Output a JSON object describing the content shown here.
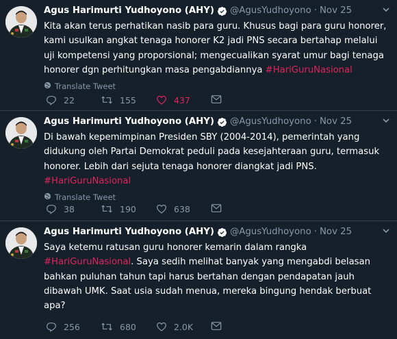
{
  "tweets": [
    {
      "name": "Agus Harimurti Yudhoyono (AHY)",
      "handle": "@AgusYudhoyono",
      "separator": "·",
      "time": "Nov 25",
      "text": "Kita akan terus perhatikan nasib para guru. Khusus bagi para guru honorer, kami usulkan angkat tenaga honorer K2 jadi PNS secara bertahap melalui uji kompetensi yang proporsional; mengecualikan syarat umur bagi tenaga honorer dgn perhitungkan masa pengabdiannya ",
      "text_after": "",
      "hashtag": "#HariGuruNasional",
      "translate_label": "Translate Tweet",
      "replies": "22",
      "retweets": "155",
      "likes": "437",
      "liked": true
    },
    {
      "name": "Agus Harimurti Yudhoyono (AHY)",
      "handle": "@AgusYudhoyono",
      "separator": "·",
      "time": "Nov 25",
      "text": "Di bawah kepemimpinan Presiden SBY (2004-2014), pemerintah yang didukung oleh Partai Demokrat peduli pada kesejahteraan guru, termasuk honorer. Lebih dari sejuta tenaga honorer diangkat jadi PNS. ",
      "text_after": "",
      "hashtag": "#HariGuruNasional",
      "translate_label": "Translate Tweet",
      "replies": "38",
      "retweets": "190",
      "likes": "638",
      "liked": false
    },
    {
      "name": "Agus Harimurti Yudhoyono (AHY)",
      "handle": "@AgusYudhoyono",
      "separator": "·",
      "time": "Nov 25",
      "text": "Saya ketemu ratusan guru honorer kemarin dalam rangka ",
      "hashtag": "#HariGuruNasional",
      "text_after": ". Saya sedih melihat banyak yang mengabdi belasan bahkan puluhan tahun tapi harus bertahan dengan pendapatan jauh dibawah UMK. Saat usia sudah menua, mereka bingung hendak berbuat apa?",
      "translate_label": "",
      "replies": "256",
      "retweets": "680",
      "likes": "2.0K",
      "liked": false
    }
  ],
  "colors": {
    "background": "#15202b",
    "divider": "#38444d",
    "muted": "#8899a6",
    "hashtag": "#e0245e",
    "liked": "#e0245e",
    "verified": "#ffffff"
  },
  "icons": [
    "avatar",
    "verified-icon",
    "chevron-down-icon",
    "globe-icon",
    "reply-icon",
    "retweet-icon",
    "heart-icon",
    "dm-icon"
  ]
}
